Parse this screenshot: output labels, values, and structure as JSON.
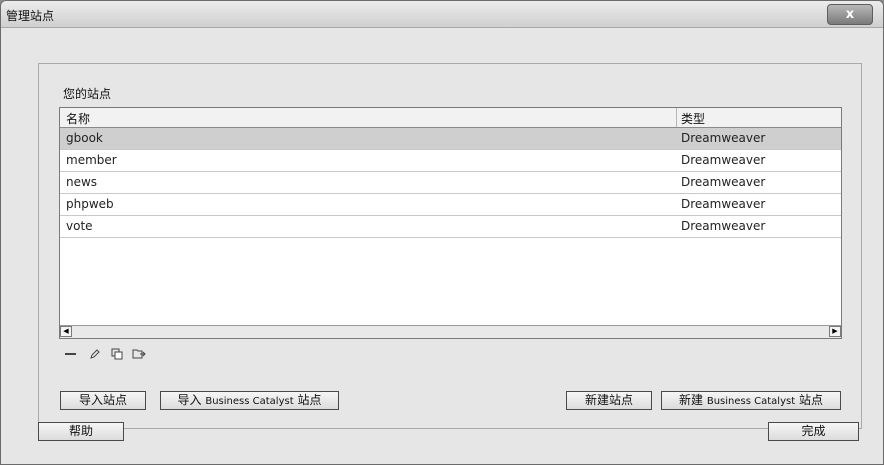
{
  "window": {
    "title": "管理站点",
    "close_label": "x"
  },
  "group": {
    "title": "您的站点"
  },
  "list": {
    "columns": [
      "名称",
      "类型"
    ],
    "rows": [
      {
        "name": "gbook",
        "type": "Dreamweaver"
      },
      {
        "name": "member",
        "type": "Dreamweaver"
      },
      {
        "name": "news",
        "type": "Dreamweaver"
      },
      {
        "name": "phpweb",
        "type": "Dreamweaver"
      },
      {
        "name": "vote",
        "type": "Dreamweaver"
      }
    ],
    "selected_index": 0
  },
  "toolbar": {
    "icons": [
      "minus-icon",
      "pencil-icon",
      "duplicate-icon",
      "export-icon"
    ]
  },
  "buttons": {
    "import_site": "导入站点",
    "import_bc_prefix": "导入",
    "import_bc_brand": "Business Catalyst",
    "import_bc_suffix": "站点",
    "new_site": "新建站点",
    "new_bc_prefix": "新建",
    "new_bc_brand": "Business Catalyst",
    "new_bc_suffix": "站点",
    "help": "帮助",
    "done": "完成"
  }
}
